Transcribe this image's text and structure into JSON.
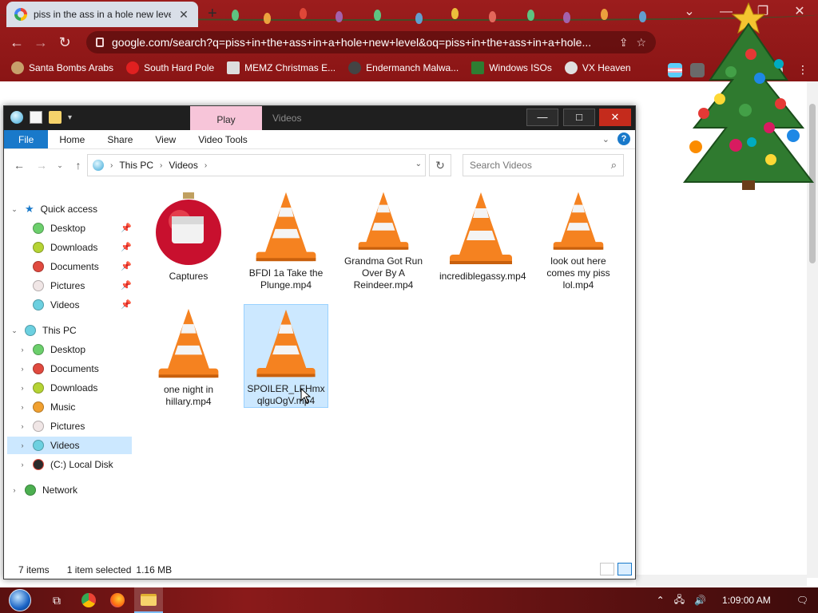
{
  "browser": {
    "tab_title": "piss in the ass in a hole new level",
    "tab_close": "✕",
    "new_tab": "+",
    "url": "google.com/search?q=piss+in+the+ass+in+a+hole+new+level&oq=piss+in+the+ass+in+a+hole...",
    "bookmarks": [
      {
        "label": "Santa Bombs Arabs",
        "icon": "santa-icon",
        "color": "#c7a06b"
      },
      {
        "label": "South Hard Pole",
        "icon": "snowflake-icon",
        "color": "#e02020"
      },
      {
        "label": "MEMZ Christmas E...",
        "icon": "memz-icon",
        "color": "#dddddd"
      },
      {
        "label": "Endermanch Malwa...",
        "icon": "enderman-icon",
        "color": "#444444"
      },
      {
        "label": "Windows ISOs",
        "icon": "tree-icon",
        "color": "#2e7d32"
      },
      {
        "label": "VX Heaven",
        "icon": "skull-icon",
        "color": "#e0e0e0"
      }
    ]
  },
  "explorer": {
    "title": "Videos",
    "context_tab": "Play",
    "ribbon_tabs": [
      "File",
      "Home",
      "Share",
      "View",
      "Video Tools"
    ],
    "breadcrumb": [
      "This PC",
      "Videos"
    ],
    "search_placeholder": "Search Videos",
    "nav": {
      "quick_access": "Quick access",
      "quick_items": [
        "Desktop",
        "Downloads",
        "Documents",
        "Pictures",
        "Videos"
      ],
      "this_pc": "This PC",
      "pc_items": [
        "Desktop",
        "Documents",
        "Downloads",
        "Music",
        "Pictures",
        "Videos",
        "(C:) Local Disk"
      ],
      "network": "Network"
    },
    "files": [
      {
        "name": "Captures",
        "kind": "folder"
      },
      {
        "name": "BFDI 1a Take the Plunge.mp4",
        "kind": "video"
      },
      {
        "name": "Grandma Got Run Over By A Reindeer.mp4",
        "kind": "video"
      },
      {
        "name": "incrediblegassy.mp4",
        "kind": "video"
      },
      {
        "name": "look out here comes my piss lol.mp4",
        "kind": "video"
      },
      {
        "name": "one night in hillary.mp4",
        "kind": "video"
      },
      {
        "name": "SPOILER_LFHmxqlguOgV.mp4",
        "kind": "video",
        "selected": true
      }
    ],
    "status": {
      "items": "7 items",
      "selected": "1 item selected",
      "size": "1.16 MB"
    }
  },
  "taskbar": {
    "time": "1:09:00 AM"
  }
}
